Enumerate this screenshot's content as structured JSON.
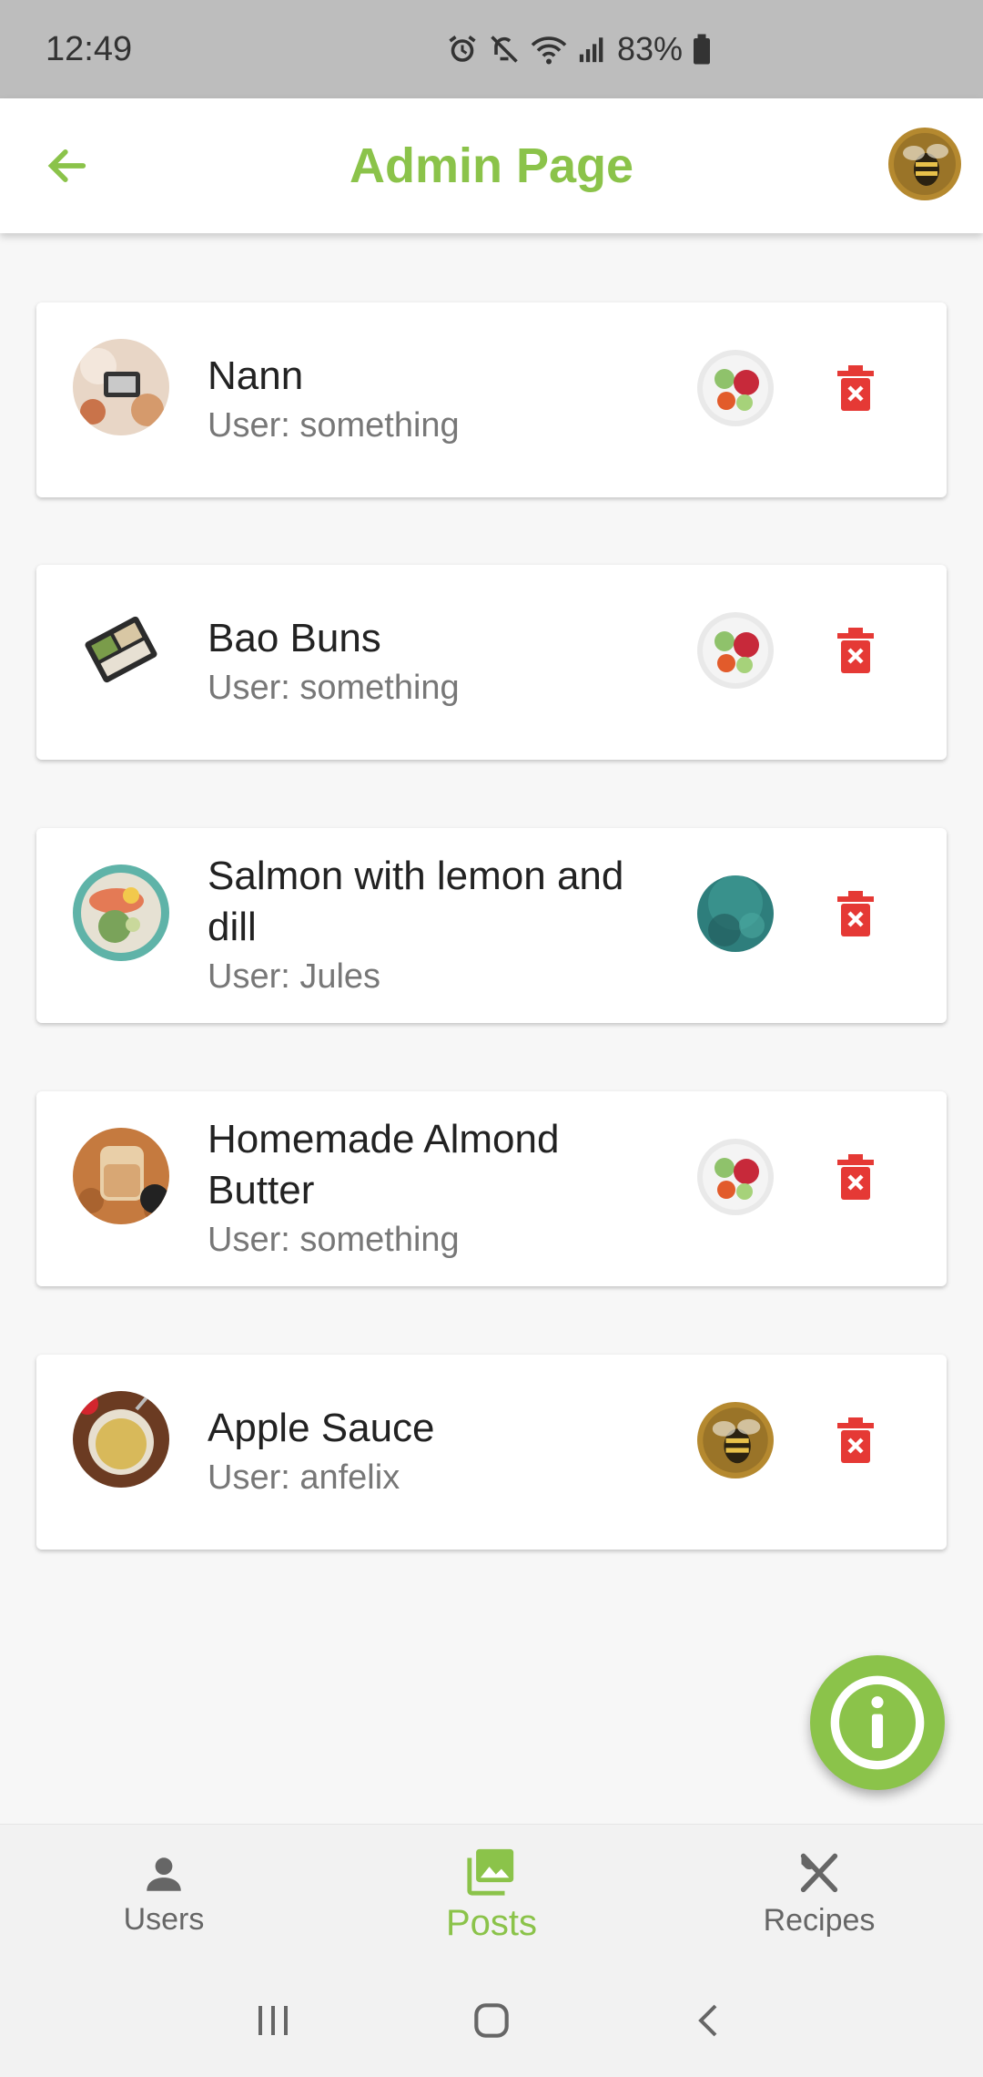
{
  "status_bar": {
    "time": "12:49",
    "battery": "83%"
  },
  "app_bar": {
    "title": "Admin Page",
    "accent_color": "#8bc34a"
  },
  "posts": [
    {
      "title": "Nann",
      "user": "User: something",
      "thumb": "phone-photo-food",
      "user_avatar": "salad-bowl"
    },
    {
      "title": "Bao Buns",
      "user": "User: something",
      "thumb": "lunch-box",
      "user_avatar": "salad-bowl"
    },
    {
      "title": "Salmon with lemon and dill",
      "user": "User: Jules",
      "thumb": "salmon-plate",
      "user_avatar": "ocean"
    },
    {
      "title": "Homemade Almond Butter",
      "user": "User: something",
      "thumb": "almond-butter-jar",
      "user_avatar": "salad-bowl"
    },
    {
      "title": "Apple Sauce",
      "user": "User: anfelix",
      "thumb": "apple-sauce-jar",
      "user_avatar": "bee"
    }
  ],
  "bottom_nav": {
    "items": [
      {
        "label": "Users",
        "icon": "person-icon"
      },
      {
        "label": "Posts",
        "icon": "image-icon",
        "active": true
      },
      {
        "label": "Recipes",
        "icon": "utensils-icon"
      }
    ]
  },
  "colors": {
    "accent": "#8bc34a",
    "delete": "#e53935"
  }
}
